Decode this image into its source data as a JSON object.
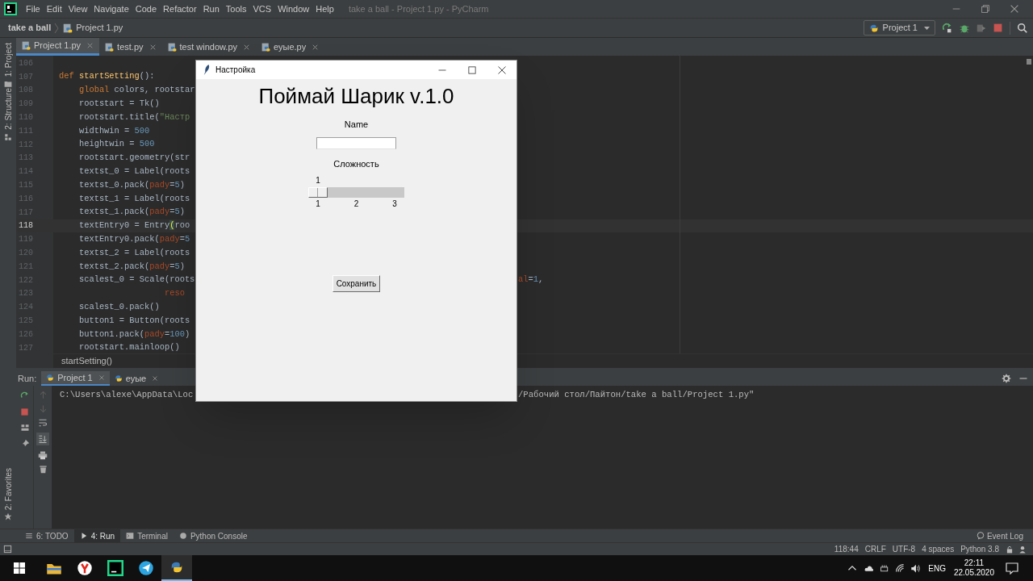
{
  "window": {
    "title": "take a ball - Project 1.py - PyCharm"
  },
  "menu": [
    "File",
    "Edit",
    "View",
    "Navigate",
    "Code",
    "Refactor",
    "Run",
    "Tools",
    "VCS",
    "Window",
    "Help"
  ],
  "breadcrumb": [
    "take a ball",
    "Project 1.py"
  ],
  "run_config": "Project 1",
  "tool_stripe": [
    "1: Project",
    "2: Structure"
  ],
  "favorites_stripe": "2: Favorites",
  "editor_tabs": [
    {
      "label": "Project 1.py",
      "selected": true
    },
    {
      "label": "test.py",
      "selected": false
    },
    {
      "label": "test window.py",
      "selected": false
    },
    {
      "label": "еуые.py",
      "selected": false
    }
  ],
  "code": {
    "lines": [
      {
        "number": "106",
        "current": false
      },
      {
        "number": "107",
        "current": false,
        "tokens": [
          {
            "text": "def ",
            "kind": "keyword"
          },
          {
            "text": "startSetting",
            "kind": "function"
          },
          {
            "text": "():",
            "kind": "plain"
          }
        ]
      },
      {
        "number": "108",
        "current": false,
        "tokens": [
          {
            "text": "    global",
            "kind": "keyword"
          },
          {
            "text": " colors, rootstar",
            "kind": "plain"
          }
        ]
      },
      {
        "number": "109",
        "current": false,
        "tokens": [
          {
            "text": "    rootstart = Tk()",
            "kind": "plain"
          }
        ]
      },
      {
        "number": "110",
        "current": false,
        "tokens": [
          {
            "text": "    rootstart.title(",
            "kind": "plain"
          },
          {
            "text": "\"Настр",
            "kind": "string"
          }
        ]
      },
      {
        "number": "111",
        "current": false,
        "tokens": [
          {
            "text": "    widthwin = ",
            "kind": "plain"
          },
          {
            "text": "500",
            "kind": "number"
          }
        ]
      },
      {
        "number": "112",
        "current": false,
        "tokens": [
          {
            "text": "    heightwin = ",
            "kind": "plain"
          },
          {
            "text": "500",
            "kind": "number"
          }
        ]
      },
      {
        "number": "113",
        "current": false,
        "tokens": [
          {
            "text": "    rootstart.geometry(str",
            "kind": "plain"
          }
        ]
      },
      {
        "number": "114",
        "current": false,
        "tokens": [
          {
            "text": "    textst_0 = Label(roots",
            "kind": "plain"
          }
        ]
      },
      {
        "number": "115",
        "current": false,
        "tokens": [
          {
            "text": "    textst_0.pack(",
            "kind": "plain"
          },
          {
            "text": "pady",
            "kind": "param"
          },
          {
            "text": "=",
            "kind": "plain"
          },
          {
            "text": "5",
            "kind": "number"
          },
          {
            "text": ")",
            "kind": "plain"
          }
        ]
      },
      {
        "number": "116",
        "current": false,
        "tokens": [
          {
            "text": "    textst_1 = Label(roots",
            "kind": "plain"
          }
        ]
      },
      {
        "number": "117",
        "current": false,
        "tokens": [
          {
            "text": "    textst_1.pack(",
            "kind": "plain"
          },
          {
            "text": "pady",
            "kind": "param"
          },
          {
            "text": "=",
            "kind": "plain"
          },
          {
            "text": "5",
            "kind": "number"
          },
          {
            "text": ")",
            "kind": "plain"
          }
        ]
      },
      {
        "number": "118",
        "current": true,
        "tokens": [
          {
            "text": "    textEntry0 = Entry",
            "kind": "plain"
          },
          {
            "text": "(",
            "kind": "brace"
          },
          {
            "text": "roo",
            "kind": "plain"
          }
        ]
      },
      {
        "number": "119",
        "current": false,
        "tokens": [
          {
            "text": "    textEntry0.pack(",
            "kind": "plain"
          },
          {
            "text": "pady",
            "kind": "param"
          },
          {
            "text": "=",
            "kind": "plain"
          },
          {
            "text": "5",
            "kind": "number"
          }
        ]
      },
      {
        "number": "120",
        "current": false,
        "tokens": [
          {
            "text": "    textst_2 = Label(roots",
            "kind": "plain"
          }
        ]
      },
      {
        "number": "121",
        "current": false,
        "tokens": [
          {
            "text": "    textst_2.pack(",
            "kind": "plain"
          },
          {
            "text": "pady",
            "kind": "param"
          },
          {
            "text": "=",
            "kind": "plain"
          },
          {
            "text": "5",
            "kind": "number"
          },
          {
            "text": ")",
            "kind": "plain"
          }
        ]
      },
      {
        "number": "122",
        "current": false,
        "tokens": [
          {
            "text": "    scalest_0 = Scale(roots",
            "kind": "plain"
          }
        ],
        "tail": [
          {
            "text": "al",
            "kind": "param"
          },
          {
            "text": "=",
            "kind": "plain"
          },
          {
            "text": "1",
            "kind": "number"
          },
          {
            "text": ",",
            "kind": "plain"
          }
        ]
      },
      {
        "number": "123",
        "current": false,
        "tokens": [
          {
            "text": "                     reso",
            "kind": "param"
          }
        ]
      },
      {
        "number": "124",
        "current": false,
        "tokens": [
          {
            "text": "    scalest_0.pack()",
            "kind": "plain"
          }
        ]
      },
      {
        "number": "125",
        "current": false,
        "tokens": [
          {
            "text": "    button1 = Button(roots",
            "kind": "plain"
          }
        ]
      },
      {
        "number": "126",
        "current": false,
        "tokens": [
          {
            "text": "    button1.pack(",
            "kind": "plain"
          },
          {
            "text": "pady",
            "kind": "param"
          },
          {
            "text": "=",
            "kind": "plain"
          },
          {
            "text": "100",
            "kind": "number"
          },
          {
            "text": ")",
            "kind": "plain"
          }
        ]
      },
      {
        "number": "127",
        "current": false,
        "tokens": [
          {
            "text": "    rootstart.mainloop()",
            "kind": "plain"
          }
        ]
      }
    ],
    "footer": "startSetting()"
  },
  "run_panel": {
    "label": "Run:",
    "tabs": [
      {
        "label": "Project 1",
        "selected": true
      },
      {
        "label": "еуые",
        "selected": false
      }
    ],
    "console": [
      "C:\\Users\\alexe\\AppData\\Loc",
      "/Рабочий стол/Пайтон/take a ball/Project 1.py\""
    ]
  },
  "tool_windows": [
    {
      "label": "6: TODO",
      "selected": false
    },
    {
      "label": "4: Run",
      "selected": true
    },
    {
      "label": "Terminal",
      "selected": false
    },
    {
      "label": "Python Console",
      "selected": false
    }
  ],
  "event_log": "Event Log",
  "status_bar": [
    "118:44",
    "CRLF",
    "UTF-8",
    "4 spaces",
    "Python 3.8"
  ],
  "dialog": {
    "title": "Настройка",
    "heading": "Поймай Шарик v.1.0",
    "name_label": "Name",
    "difficulty_label": "Сложность",
    "scale": {
      "value": "1",
      "level": 0,
      "ticks": [
        "1",
        "2",
        "3"
      ]
    },
    "button": "Сохранить"
  },
  "taskbar": {
    "apps": [
      {
        "kind": "explorer",
        "selected": false
      },
      {
        "kind": "browser",
        "selected": false
      },
      {
        "kind": "ide",
        "selected": false
      },
      {
        "kind": "messenger",
        "selected": false
      },
      {
        "kind": "python",
        "selected": true
      }
    ],
    "language": "ENG",
    "time": "22:11",
    "date": "22.05.2020"
  }
}
